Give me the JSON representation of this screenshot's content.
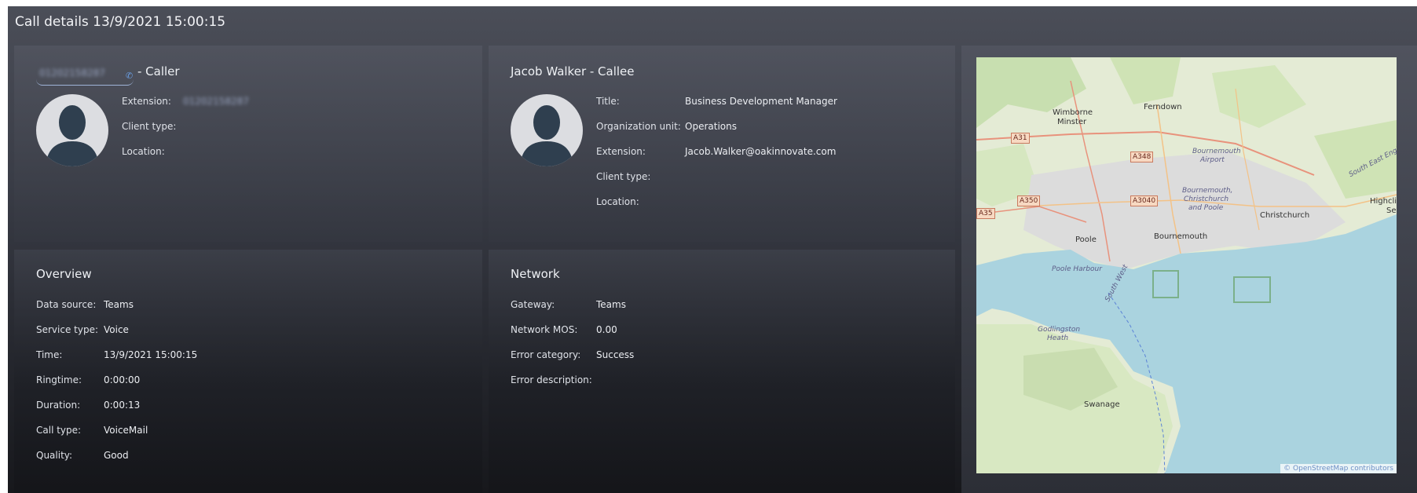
{
  "header": {
    "title": "Call details 13/9/2021 15:00:15"
  },
  "caller": {
    "number_blurred": "01202158287",
    "heading_suffix": "- Caller",
    "extension_label": "Extension:",
    "extension_value_blurred": "01202158287",
    "client_type_label": "Client type:",
    "location_label": "Location:"
  },
  "callee": {
    "heading": "Jacob Walker - Callee",
    "fields": [
      {
        "label": "Title:",
        "value": "Business Development Manager"
      },
      {
        "label": "Organization unit:",
        "value": "Operations"
      },
      {
        "label": "Extension:",
        "value": "Jacob.Walker@oakinnovate.com"
      },
      {
        "label": "Client type:",
        "value": ""
      },
      {
        "label": "Location:",
        "value": ""
      }
    ]
  },
  "overview": {
    "heading": "Overview",
    "fields": [
      {
        "label": "Data source:",
        "value": "Teams"
      },
      {
        "label": "Service type:",
        "value": "Voice"
      },
      {
        "label": "Time:",
        "value": "13/9/2021 15:00:15"
      },
      {
        "label": "Ringtime:",
        "value": "0:00:00"
      },
      {
        "label": "Duration:",
        "value": "0:00:13"
      },
      {
        "label": "Call type:",
        "value": "VoiceMail"
      },
      {
        "label": "Quality:",
        "value": "Good"
      }
    ]
  },
  "network": {
    "heading": "Network",
    "fields": [
      {
        "label": "Gateway:",
        "value": "Teams"
      },
      {
        "label": "Network MOS:",
        "value": "0.00"
      },
      {
        "label": "Error category:",
        "value": "Success"
      },
      {
        "label": "Error description:",
        "value": ""
      }
    ]
  },
  "map": {
    "places": [
      "Wimborne",
      "Minster",
      "Ferndown",
      "Bournemouth",
      "Airport",
      "Poole",
      "Bournemouth",
      "Christchurch",
      "Highclif",
      "Se",
      "Swanage",
      "Poole Harbour",
      "Godlingston",
      "Heath",
      "South West",
      "South East England",
      "Bournemouth,",
      "Christchurch",
      "and Poole"
    ],
    "roads": [
      "A31",
      "A348",
      "A350",
      "A3040",
      "A35"
    ],
    "attribution": "© OpenStreetMap contributors"
  },
  "colors": {
    "accent": "#6aa0e8",
    "sea": "#aad3df",
    "land": "#e4ebd5"
  }
}
